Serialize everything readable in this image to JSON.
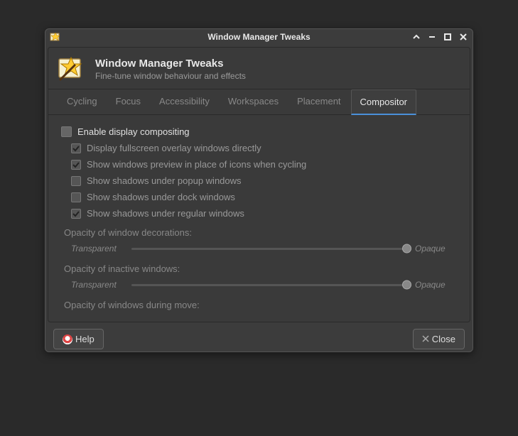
{
  "window": {
    "title": "Window Manager Tweaks"
  },
  "header": {
    "title": "Window Manager Tweaks",
    "subtitle": "Fine-tune window behaviour and effects"
  },
  "tabs": [
    {
      "label": "Cycling"
    },
    {
      "label": "Focus"
    },
    {
      "label": "Accessibility"
    },
    {
      "label": "Workspaces"
    },
    {
      "label": "Placement"
    },
    {
      "label": "Compositor"
    }
  ],
  "compositor": {
    "enable": "Enable display compositing",
    "opts": [
      "Display fullscreen overlay windows directly",
      "Show windows preview in place of icons when cycling",
      "Show shadows under popup windows",
      "Show shadows under dock windows",
      "Show shadows under regular windows"
    ],
    "sliders": {
      "decorations": "Opacity of window decorations:",
      "inactive": "Opacity of inactive windows:",
      "move": "Opacity of windows during move:",
      "left": "Transparent",
      "right": "Opaque"
    }
  },
  "buttons": {
    "help": "Help",
    "close": "Close"
  }
}
